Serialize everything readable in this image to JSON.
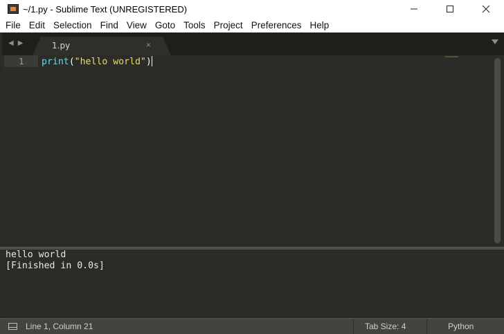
{
  "window": {
    "title": "~/1.py - Sublime Text (UNREGISTERED)",
    "minimize_icon": "minimize-icon",
    "maximize_icon": "maximize-icon",
    "close_icon": "close-icon"
  },
  "menu": {
    "items": [
      "File",
      "Edit",
      "Selection",
      "Find",
      "View",
      "Goto",
      "Tools",
      "Project",
      "Preferences",
      "Help"
    ]
  },
  "tabs": {
    "nav_left": "◀",
    "nav_right": "▶",
    "items": [
      {
        "label": "1.py",
        "close": "×"
      }
    ]
  },
  "editor": {
    "line_number": "1",
    "code": {
      "fn": "print",
      "open_paren": "(",
      "string": "\"hello world\"",
      "close_paren": ")"
    }
  },
  "output": {
    "lines": [
      "hello world",
      "[Finished in 0.0s]"
    ]
  },
  "status": {
    "position": "Line 1, Column 21",
    "tab_size": "Tab Size: 4",
    "syntax": "Python"
  },
  "colors": {
    "editor_bg": "#2b2c27",
    "function": "#66d9ef",
    "string": "#e6db74",
    "text": "#f8f8f2",
    "status_bg": "#434440"
  }
}
